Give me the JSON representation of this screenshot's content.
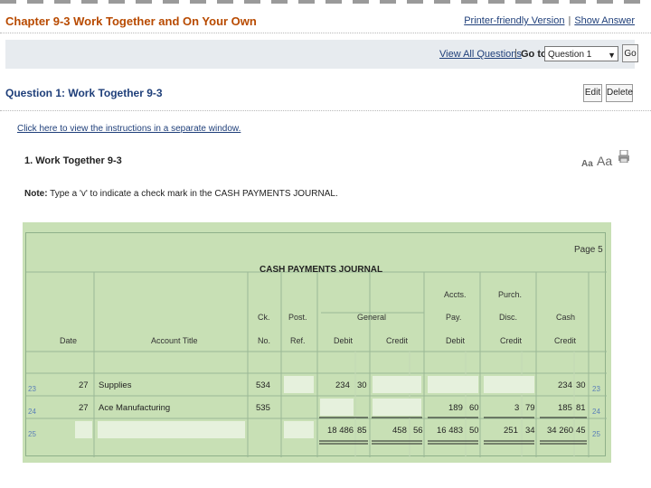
{
  "header": {
    "chapter_title": "Chapter 9-3 Work Together and On Your Own",
    "printer_friendly": "Printer-friendly Version",
    "separator": "|",
    "show_answer": "Show Answer"
  },
  "nav": {
    "view_all": "View All Questions",
    "separator": "|",
    "goto_label": "Go to:",
    "goto_selected": "Question 1",
    "go_button": "Go"
  },
  "question": {
    "title": "Question 1: Work Together 9-3",
    "edit": "Edit",
    "delete": "Delete",
    "instructions_link": "Click here to view the instructions in a separate window.",
    "problem_title": "1.  Work Together 9-3",
    "font_small": "Aa",
    "font_large": "Aa",
    "note_label": "Note:",
    "note_text": " Type a 'v' to indicate a check mark in the CASH PAYMENTS JOURNAL."
  },
  "journal": {
    "page": "Page 5",
    "title": "CASH PAYMENTS JOURNAL",
    "headers": {
      "accts": "Accts.",
      "purch": "Purch.",
      "ck": "Ck.",
      "post": "Post.",
      "general": "General",
      "pay": "Pay.",
      "disc": "Disc.",
      "cash": "Cash",
      "date": "Date",
      "account_title": "Account Title",
      "no": "No.",
      "ref": "Ref.",
      "debit": "Debit",
      "credit": "Credit",
      "ap_debit": "Debit",
      "pd_credit": "Credit",
      "cash_credit": "Credit"
    },
    "rows": [
      {
        "line": "23",
        "day": "27",
        "account": "Supplies",
        "ck": "534",
        "gen_debit_d": "234",
        "gen_debit_c": "30",
        "cash_d": "234",
        "cash_c": "30",
        "line_r": "23"
      },
      {
        "line": "24",
        "day": "27",
        "account": "Ace Manufacturing",
        "ck": "535",
        "ap_debit_d": "189",
        "ap_debit_c": "60",
        "disc_d": "3",
        "disc_c": "79",
        "cash_d": "185",
        "cash_c": "81",
        "line_r": "24"
      },
      {
        "line": "25",
        "gen_debit_d": "18 486",
        "gen_debit_c": "85",
        "gen_credit_d": "458",
        "gen_credit_c": "56",
        "ap_debit_d": "16 483",
        "ap_debit_c": "50",
        "disc_d": "251",
        "disc_c": "34",
        "cash_d": "34 260",
        "cash_c": "45",
        "line_r": "25"
      }
    ]
  }
}
